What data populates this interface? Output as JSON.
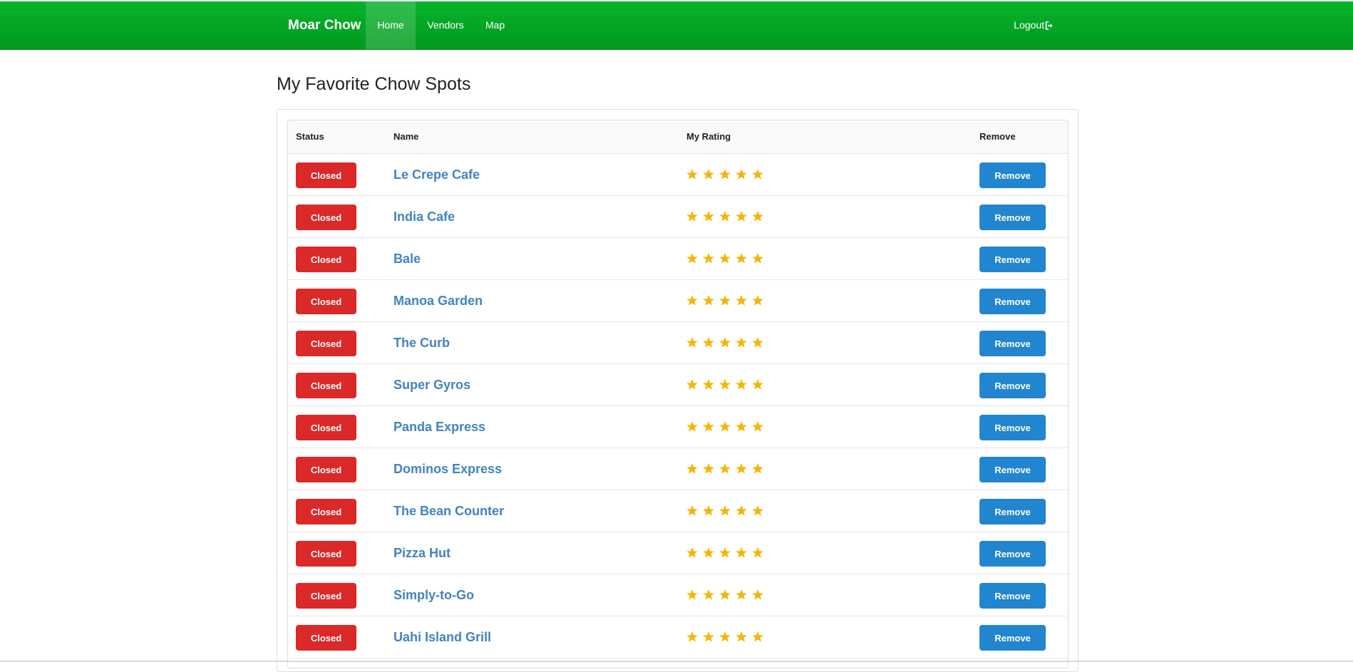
{
  "navbar": {
    "brand": "Moar Chow",
    "links": [
      {
        "label": "Home",
        "active": true
      },
      {
        "label": "Vendors",
        "active": false
      },
      {
        "label": "Map",
        "active": false
      }
    ],
    "logout_label": "Logout",
    "color": "#03a824"
  },
  "page": {
    "title": "My Favorite Chow Spots"
  },
  "table": {
    "headers": {
      "status": "Status",
      "name": "Name",
      "rating": "My Rating",
      "remove": "Remove"
    },
    "rows": [
      {
        "status": "Closed",
        "name": "Le Crepe Cafe",
        "rating": 5,
        "action": "Remove"
      },
      {
        "status": "Closed",
        "name": "India Cafe",
        "rating": 5,
        "action": "Remove"
      },
      {
        "status": "Closed",
        "name": "Bale",
        "rating": 5,
        "action": "Remove"
      },
      {
        "status": "Closed",
        "name": "Manoa Garden",
        "rating": 5,
        "action": "Remove"
      },
      {
        "status": "Closed",
        "name": "The Curb",
        "rating": 5,
        "action": "Remove"
      },
      {
        "status": "Closed",
        "name": "Super Gyros",
        "rating": 5,
        "action": "Remove"
      },
      {
        "status": "Closed",
        "name": "Panda Express",
        "rating": 5,
        "action": "Remove"
      },
      {
        "status": "Closed",
        "name": "Dominos Express",
        "rating": 5,
        "action": "Remove"
      },
      {
        "status": "Closed",
        "name": "The Bean Counter",
        "rating": 5,
        "action": "Remove"
      },
      {
        "status": "Closed",
        "name": "Pizza Hut",
        "rating": 5,
        "action": "Remove"
      },
      {
        "status": "Closed",
        "name": "Simply-to-Go",
        "rating": 5,
        "action": "Remove"
      },
      {
        "status": "Closed",
        "name": "Uahi Island Grill",
        "rating": 5,
        "action": "Remove"
      }
    ],
    "max_rating": 5
  },
  "colors": {
    "status_closed": "#db2828",
    "remove_button": "#2185d0",
    "vendor_link": "#4183c4",
    "star": "#f5b50a"
  },
  "icons": {
    "logout": "sign-out-icon",
    "rating": "star-icon"
  }
}
